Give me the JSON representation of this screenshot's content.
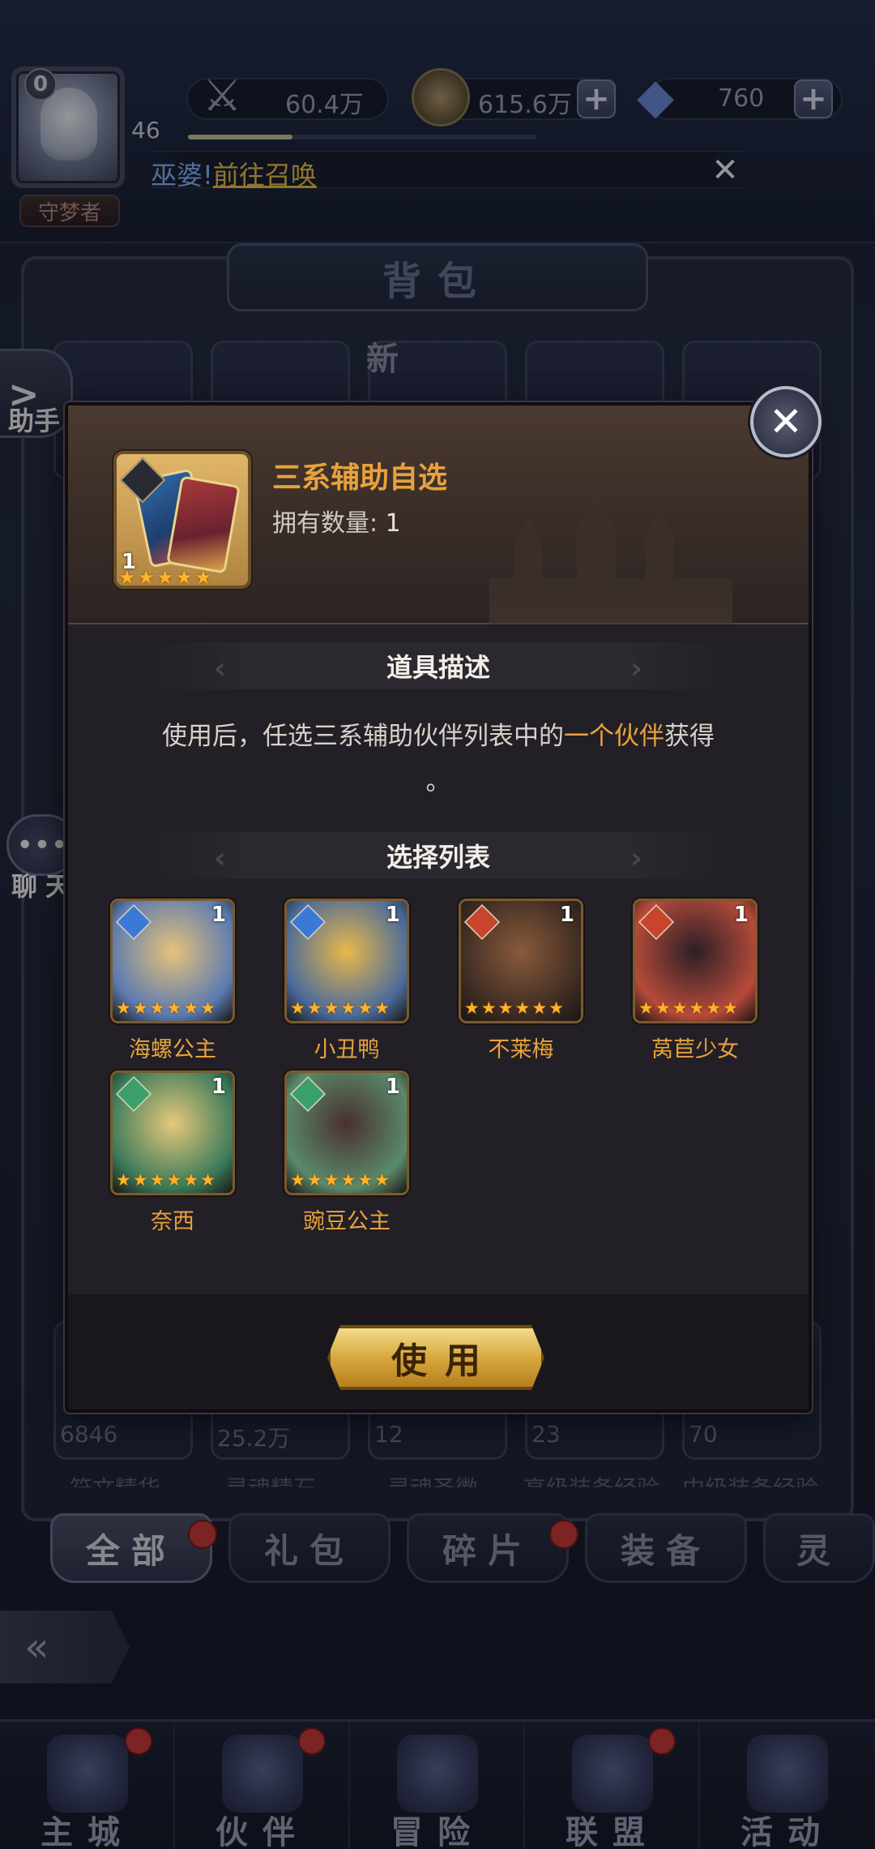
{
  "player": {
    "vip": "0",
    "level": "46",
    "title": "守梦者",
    "xp_fraction": 0.3
  },
  "resources": {
    "power": "60.4万",
    "gold": "615.6万",
    "diamonds": "760"
  },
  "marquee": {
    "prefix": "巫婆!",
    "link": "前往召唤"
  },
  "bag": {
    "title": "背包",
    "new_badge": "新",
    "bottom_counts": [
      "6846",
      "25.2万",
      "12",
      "23",
      "70"
    ],
    "bottom_labels": [
      "符文精华",
      "灵魂精石",
      "灵魂圣徽",
      "高级装备经验",
      "中级装备经验"
    ],
    "tabs": [
      "全部",
      "礼包",
      "碎片",
      "装备",
      "灵"
    ]
  },
  "side": {
    "assist_label": "助手",
    "chat_label": "聊天"
  },
  "modal": {
    "item_name": "三系辅助自选",
    "own_label": "拥有数量:",
    "own_count": "1",
    "item_qty": "1",
    "item_stars": 5,
    "desc_title": "道具描述",
    "desc_before": "使用后，任选三系辅助伙伴列表中的",
    "desc_highlight": "一个伙伴",
    "desc_after": "获得",
    "desc_tail": "。",
    "list_title": "选择列表",
    "use_button": "使用",
    "heroes": [
      {
        "name": "海螺公主",
        "qty": "1",
        "element": "water",
        "stars": 6
      },
      {
        "name": "小丑鸭",
        "qty": "1",
        "element": "water",
        "stars": 6
      },
      {
        "name": "不莱梅",
        "qty": "1",
        "element": "fire",
        "stars": 6
      },
      {
        "name": "莴苣少女",
        "qty": "1",
        "element": "fire",
        "stars": 6
      },
      {
        "name": "奈西",
        "qty": "1",
        "element": "nature",
        "stars": 6
      },
      {
        "name": "豌豆公主",
        "qty": "1",
        "element": "nature",
        "stars": 6
      }
    ]
  },
  "nav": {
    "items": [
      "主城",
      "伙伴",
      "冒险",
      "联盟",
      "活动"
    ]
  },
  "colors": {
    "accent_orange": "#e8a23c",
    "water": "#3a7ad6",
    "fire": "#c8442c",
    "nature": "#3aa06a"
  }
}
